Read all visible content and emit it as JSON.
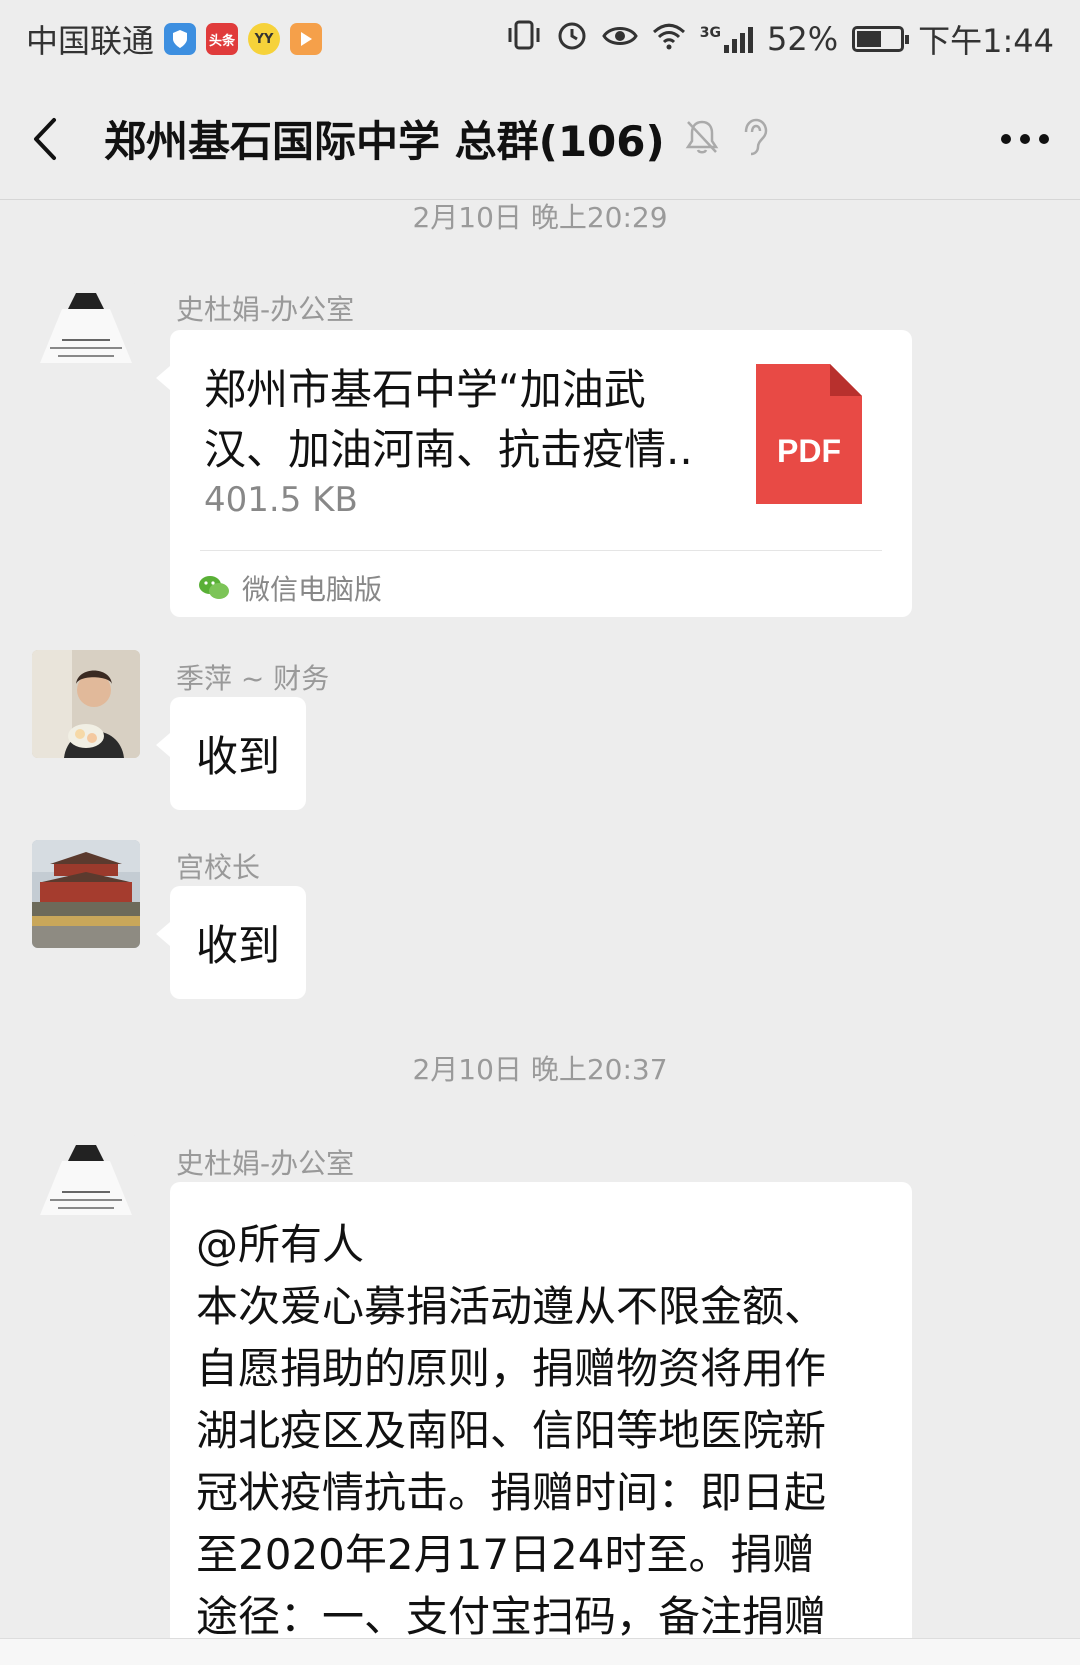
{
  "status_bar": {
    "carrier": "中国联通",
    "app_badges": [
      "shield-icon",
      "toutiao-icon",
      "yy-icon",
      "video-icon"
    ],
    "network_tag": "3G",
    "battery": "52%",
    "battery_level": 0.52,
    "time": "下午1:44"
  },
  "header": {
    "title": "郑州基石国际中学 总群(106)"
  },
  "messages": [
    {
      "timestamp": "2月10日 晚上20:29"
    },
    {
      "sender": "史杜娟-办公室",
      "type": "file",
      "file_title": "郑州市基石中学“加油武汉、加油河南、抗击疫情..",
      "file_size": "401.5 KB",
      "file_type": "PDF",
      "source": "微信电脑版"
    },
    {
      "sender": "季萍 ~ 财务",
      "type": "text",
      "text": "收到"
    },
    {
      "sender": "宫校长",
      "type": "text",
      "text": "收到"
    },
    {
      "timestamp": "2月10日 晚上20:37"
    },
    {
      "sender": "史杜娟-办公室",
      "type": "text",
      "text": "@所有人\n本次爱心募捐活动遵从不限金额、自愿捐助的原则，捐赠物资将用作湖北疫区及南阳、信阳等地医院新冠状疫情抗击。捐赠时间：即日起至2020年2月17日24时至。捐赠途径：一、支付宝扫码，备注捐赠"
    }
  ],
  "colors": {
    "background": "#ededed",
    "bubble": "#ffffff",
    "pdf_red": "#e84a45",
    "wechat_green": "#59b036"
  }
}
